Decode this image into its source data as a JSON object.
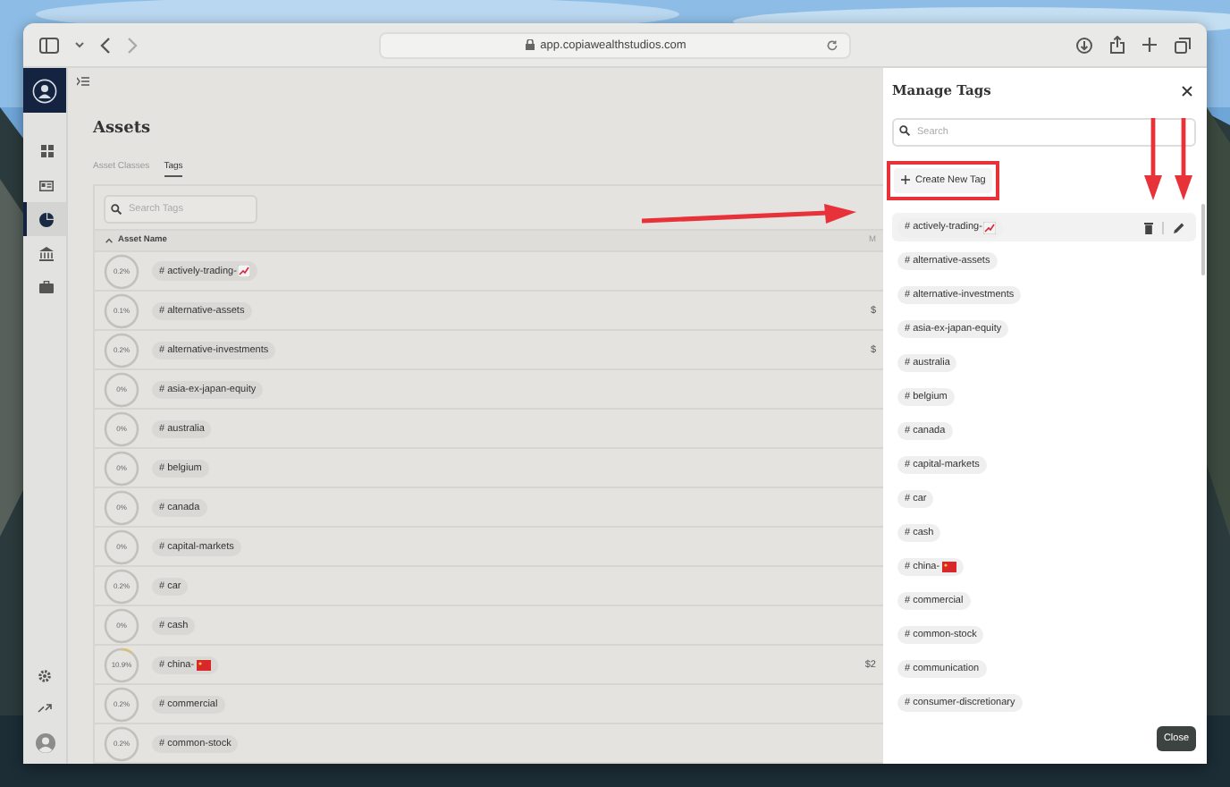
{
  "browser": {
    "url": "app.copiawealthstudios.com"
  },
  "sidebar": {
    "items": [
      {
        "kind": "grid",
        "selected": false
      },
      {
        "kind": "card",
        "selected": false
      },
      {
        "kind": "pie",
        "selected": true
      },
      {
        "kind": "bank",
        "selected": false
      },
      {
        "kind": "briefcase",
        "selected": false
      }
    ]
  },
  "page": {
    "title": "Assets",
    "tabs": [
      {
        "label": "Asset Classes",
        "selected": false
      },
      {
        "label": "Tags",
        "selected": true
      }
    ],
    "search": {
      "placeholder": "Search Tags"
    },
    "table": {
      "columns": [
        "Asset Name",
        "M"
      ],
      "rows": [
        {
          "share": "0.2%",
          "level": 0.002,
          "tag": "# actively-trading-",
          "kind": "chart"
        },
        {
          "share": "0.1%",
          "level": 0.001,
          "tag": "# alternative-assets",
          "value": "$"
        },
        {
          "share": "0.2%",
          "level": 0.002,
          "tag": "# alternative-investments",
          "value": "$"
        },
        {
          "share": "0%",
          "level": 0,
          "tag": "# asia-ex-japan-equity"
        },
        {
          "share": "0%",
          "level": 0,
          "tag": "# australia"
        },
        {
          "share": "0%",
          "level": 0,
          "tag": "# belgium"
        },
        {
          "share": "0%",
          "level": 0,
          "tag": "# canada"
        },
        {
          "share": "0%",
          "level": 0,
          "tag": "# capital-markets"
        },
        {
          "share": "0.2%",
          "level": 0.002,
          "tag": "# car"
        },
        {
          "share": "0%",
          "level": 0,
          "tag": "# cash"
        },
        {
          "share": "10.9%",
          "level": 0.109,
          "tag": "# china-",
          "kind": "flag",
          "value": "$2"
        },
        {
          "share": "0.2%",
          "level": 0.002,
          "tag": "# commercial"
        },
        {
          "share": "0.2%",
          "level": 0.002,
          "tag": "# common-stock"
        }
      ]
    }
  },
  "panel": {
    "title": "Manage Tags",
    "search": {
      "placeholder": "Search"
    },
    "create_button": "Create New Tag",
    "tags": [
      {
        "label": "# actively-trading-",
        "kind": "chart",
        "selected": true
      },
      {
        "label": "# alternative-assets",
        "selected": false
      },
      {
        "label": "# alternative-investments",
        "selected": false
      },
      {
        "label": "# asia-ex-japan-equity",
        "selected": false
      },
      {
        "label": "# australia",
        "selected": false
      },
      {
        "label": "# belgium",
        "selected": false
      },
      {
        "label": "# canada",
        "selected": false
      },
      {
        "label": "# capital-markets",
        "selected": false
      },
      {
        "label": "# car",
        "selected": false
      },
      {
        "label": "# cash",
        "selected": false
      },
      {
        "label": "# china-",
        "kind": "flag",
        "selected": false
      },
      {
        "label": "# commercial",
        "selected": false
      },
      {
        "label": "# common-stock",
        "selected": false
      },
      {
        "label": "# communication",
        "selected": false
      },
      {
        "label": "# consumer-discretionary",
        "selected": false
      }
    ],
    "close_button": "Close"
  }
}
